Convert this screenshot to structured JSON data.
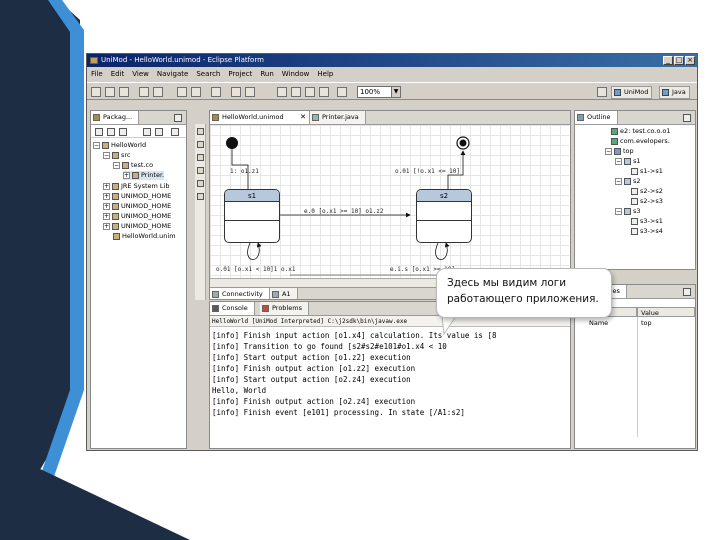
{
  "window": {
    "title": "UniMod - HelloWorld.unimod - Eclipse Platform",
    "controls": [
      "_",
      "□",
      "×"
    ]
  },
  "menu": [
    "File",
    "Edit",
    "View",
    "Navigate",
    "Search",
    "Project",
    "Run",
    "Window",
    "Help"
  ],
  "toolbar": {
    "zoom_value": "100%",
    "perspectives": [
      "UniMod",
      "Java"
    ]
  },
  "package_explorer": {
    "tab": "Packag...",
    "tree": [
      {
        "expander": "−",
        "label": "HelloWorld"
      },
      {
        "expander": "−",
        "label": "src"
      },
      {
        "expander": "−",
        "label": "test.co"
      },
      {
        "expander": "+",
        "label": "Printer."
      },
      {
        "expander": "+",
        "label": "JRE System Lib"
      },
      {
        "expander": "+",
        "label": "UNIMOD_HOME"
      },
      {
        "expander": "+",
        "label": "UNIMOD_HOME"
      },
      {
        "expander": "+",
        "label": "UNIMOD_HOME"
      },
      {
        "expander": "+",
        "label": "UNIMOD_HOME"
      },
      {
        "expander": "",
        "label": "HelloWorld.unim"
      }
    ]
  },
  "editor": {
    "tabs": [
      "HelloWorld.unimod",
      "Printer.java"
    ],
    "states": [
      {
        "name": "s1"
      },
      {
        "name": "s2"
      }
    ],
    "labels": {
      "initial": "1: o1.z1",
      "top_right": "o.01 [!o.x1 <= 10]",
      "middle": "e.0 [o.x1 >= 10] o1.z2",
      "bottom_left": "o.01 [o.x1 < 10]1 o.x1",
      "bottom_right": "e.i.s [o.x1 >= 10]"
    },
    "bottom_tabs": [
      "Connectivity",
      "A1"
    ]
  },
  "outline": {
    "tab": "Outline",
    "items": [
      {
        "indent": 0,
        "label": "e2: test.co.o.o1"
      },
      {
        "indent": 0,
        "label": "com.evelopers."
      },
      {
        "indent": 0,
        "label": "top"
      },
      {
        "indent": 1,
        "label": "s1"
      },
      {
        "indent": 2,
        "label": "s1->s1"
      },
      {
        "indent": 1,
        "label": "s2"
      },
      {
        "indent": 2,
        "label": "s2->s2"
      },
      {
        "indent": 2,
        "label": "s2->s3"
      },
      {
        "indent": 1,
        "label": "s3"
      },
      {
        "indent": 2,
        "label": "s3->s1"
      },
      {
        "indent": 2,
        "label": "s3->s4"
      }
    ]
  },
  "console": {
    "tabs": [
      "Console",
      "Problems"
    ],
    "path": "HelloWorld [UniMod Interpreted] C:\\j2sdk\\bin\\javaw.exe",
    "lines": [
      "[info] Finish input action [o1.x4] calculation. Its value is [8",
      "[info] Transition to go found [s2#s2#e101#o1.x4 < 10",
      "[info] Start output action [o1.z2] execution",
      "[info] Finish output action [o1.z2] execution",
      "[info] Start output action [o2.z4] execution",
      "Hello, World",
      "[info] Finish output action [o2.z4] execution",
      "[info] Finish event [e101] processing. In state [/A1:s2]"
    ]
  },
  "properties": {
    "tabs": [
      "Properties"
    ],
    "columns": [
      "Property",
      "Value"
    ],
    "rows": [
      {
        "name": "Name",
        "value": "top"
      }
    ]
  },
  "callout": {
    "text": "Здесь мы видим логи работающего приложения."
  }
}
